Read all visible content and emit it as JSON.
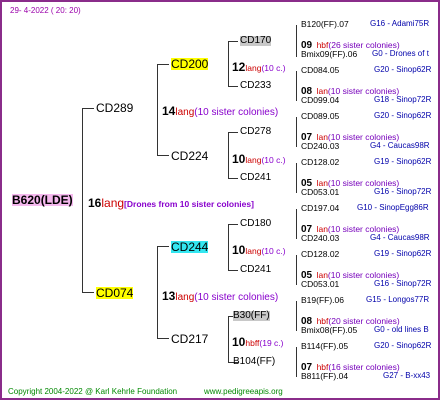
{
  "date": "29- 4-2022 ( 20: 20)",
  "footer": {
    "copyright": "Copyright 2004-2022 @ Karl Kehrle Foundation",
    "site": "www.pedigreeapis.org"
  },
  "queen": {
    "id": "B620(LDE)",
    "num": "16",
    "lang": "lang",
    "desc": "[Drones from 10 sister colonies]"
  },
  "gen1": [
    {
      "id": "CD289",
      "num": "14",
      "lang": "lang",
      "desc": "(10 sister colonies)"
    },
    {
      "id": "CD074",
      "num": "13",
      "lang": "lang",
      "desc": "(10 sister colonies)"
    }
  ],
  "gen2": [
    {
      "id": "CD200",
      "num": "12",
      "lang": "lang",
      "desc": "(10 c.)"
    },
    {
      "id": "CD224",
      "num": "10",
      "lang": "lang",
      "desc": "(10 c.)"
    },
    {
      "id": "CD244",
      "num": "10",
      "lang": "lang",
      "desc": "(10 c.)"
    },
    {
      "id": "CD217",
      "num": "10",
      "lang": "hbff",
      "desc": "(19 c.)"
    }
  ],
  "gen3": [
    {
      "id": "CD170",
      "num": "09",
      "lang": "hbf",
      "desc": "(26 sister colonies)"
    },
    {
      "id": "CD233",
      "num": "08",
      "lang": "lan",
      "desc": "(10 sister colonies)"
    },
    {
      "id": "CD278",
      "num": "07",
      "lang": "lan",
      "desc": "(10 sister colonies)"
    },
    {
      "id": "CD241",
      "num": "05",
      "lang": "lan",
      "desc": "(10 sister colonies)"
    },
    {
      "id": "CD180",
      "num": "07",
      "lang": "lan",
      "desc": "(10 sister colonies)"
    },
    {
      "id": "CD241",
      "num": "05",
      "lang": "lan",
      "desc": "(10 sister colonies)"
    },
    {
      "id": "B30(FF)",
      "num": "08",
      "lang": "hbf",
      "desc": "(20 sister colonies)"
    },
    {
      "id": "B104(FF)",
      "num": "07",
      "lang": "hbf",
      "desc": "(16 sister colonies)"
    }
  ],
  "gen4": [
    {
      "id": "B120(FF).07",
      "info": "G16 - Adami75R"
    },
    {
      "id": "Bmix09(FF).06",
      "info": "G0 - Drones of t"
    },
    {
      "id": "CD084.05",
      "info": "G20 - Sinop62R"
    },
    {
      "id": "CD099.04",
      "info": "G18 - Sinop72R"
    },
    {
      "id": "CD089.05",
      "info": "G20 - Sinop62R"
    },
    {
      "id": "CD240.03",
      "info": "G4 - Caucas98R"
    },
    {
      "id": "CD128.02",
      "info": "G19 - Sinop62R"
    },
    {
      "id": "CD053.01",
      "info": "G16 - Sinop72R"
    },
    {
      "id": "CD197.04",
      "info": "G10 - SinopEgg86R"
    },
    {
      "id": "CD240.03",
      "info": "G4 - Caucas98R"
    },
    {
      "id": "CD128.02",
      "info": "G19 - Sinop62R"
    },
    {
      "id": "CD053.01",
      "info": "G16 - Sinop72R"
    },
    {
      "id": "B19(FF).06",
      "info": "G15 - Longos77R"
    },
    {
      "id": "Bmix08(FF).05",
      "info": "G0 - old lines B"
    },
    {
      "id": "B114(FF).05",
      "info": "G20 - Sinop62R"
    },
    {
      "id": "B811(FF).04",
      "info": "G27 - B-xx43"
    }
  ]
}
